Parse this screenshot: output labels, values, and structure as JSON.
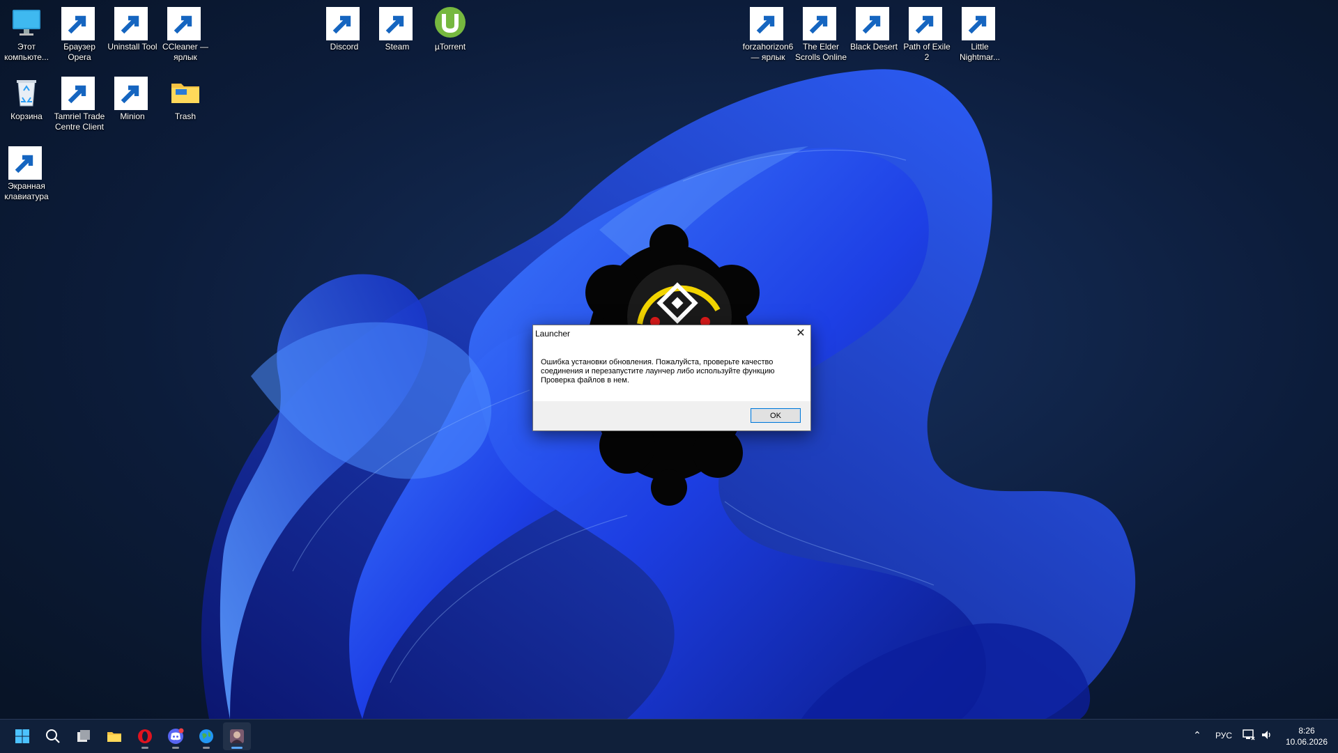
{
  "desktop": {
    "icons": [
      {
        "id": "this-pc",
        "label": "Этот компьюте...",
        "icon": "monitor-icon",
        "shortcut": false
      },
      {
        "id": "opera",
        "label": "Браузер Opera",
        "icon": "opera-icon",
        "shortcut": true
      },
      {
        "id": "uninstall-tool",
        "label": "Uninstall Tool",
        "icon": "uninstall-tool-icon",
        "shortcut": true
      },
      {
        "id": "ccleaner",
        "label": "CCleaner — ярлык",
        "icon": "ccleaner-icon",
        "shortcut": true
      },
      {
        "id": "recycle-bin",
        "label": "Корзина",
        "icon": "recycle-bin-icon",
        "shortcut": false
      },
      {
        "id": "tamriel-trade",
        "label": "Tamriel Trade Centre Client",
        "icon": "tamriel-trade-icon",
        "shortcut": true
      },
      {
        "id": "minion",
        "label": "Minion",
        "icon": "minion-icon",
        "shortcut": true
      },
      {
        "id": "trash",
        "label": "Trash",
        "icon": "folder-icon",
        "shortcut": false
      },
      {
        "id": "on-screen-keyboard",
        "label": "Экранная клавиатура",
        "icon": "keyboard-icon",
        "shortcut": true
      },
      {
        "id": "discord",
        "label": "Discord",
        "icon": "discord-icon",
        "shortcut": true
      },
      {
        "id": "steam",
        "label": "Steam",
        "icon": "steam-icon",
        "shortcut": true
      },
      {
        "id": "utorrent",
        "label": "µTorrent",
        "icon": "utorrent-icon",
        "shortcut": false
      },
      {
        "id": "forza",
        "label": "forzahorizon6 — ярлык",
        "icon": "forza-icon",
        "shortcut": true
      },
      {
        "id": "eso",
        "label": "The Elder Scrolls Online",
        "icon": "eso-icon",
        "shortcut": true
      },
      {
        "id": "black-desert",
        "label": "Black Desert",
        "icon": "black-desert-icon",
        "shortcut": true
      },
      {
        "id": "poe2",
        "label": "Path of Exile 2",
        "icon": "poe-icon",
        "shortcut": true
      },
      {
        "id": "little-nightmares",
        "label": "Little Nightmar...",
        "icon": "little-nightmares-icon",
        "shortcut": true
      }
    ]
  },
  "dialog": {
    "title": "Launcher",
    "message": "Ошибка установки обновления. Пожалуйста, проверьте качество соединения и перезапустите лаунчер либо используйте функцию Проверка файлов в нем.",
    "ok_label": "OK",
    "close_icon": "close-icon"
  },
  "taskbar": {
    "items": [
      {
        "id": "start",
        "icon": "windows-start-icon",
        "active": false,
        "running": false
      },
      {
        "id": "search",
        "icon": "search-icon",
        "active": false,
        "running": false
      },
      {
        "id": "task-view",
        "icon": "task-view-icon",
        "active": false,
        "running": false
      },
      {
        "id": "explorer",
        "icon": "file-explorer-icon",
        "active": false,
        "running": false
      },
      {
        "id": "opera",
        "icon": "opera-icon",
        "active": false,
        "running": true
      },
      {
        "id": "discord",
        "icon": "discord-icon",
        "active": false,
        "running": true
      },
      {
        "id": "browser",
        "icon": "globe-icon",
        "active": false,
        "running": true
      },
      {
        "id": "launcher",
        "icon": "launcher-app-icon",
        "active": true,
        "running": true
      }
    ],
    "tray": {
      "language": "РУС",
      "time": "8:26",
      "date": "10.06.2026"
    }
  },
  "colors": {
    "wallpaper_dark": "#0a1a33",
    "bloom_blue": "#1f4fff",
    "taskbar_bg": "#10203a",
    "accent": "#0078d7"
  }
}
